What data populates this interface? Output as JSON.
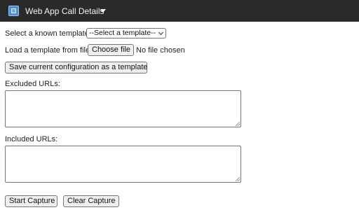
{
  "app": {
    "title": "Web App Call Details",
    "icon": "app-window-icon",
    "menu_icon": "chevron-down-icon"
  },
  "template": {
    "select_label": "Select a known template:",
    "select_value": "--Select a template--",
    "load_label": "Load a template from file:",
    "choose_file_label": "Choose file",
    "file_status": "No file chosen",
    "save_button_label": "Save current configuration as a template"
  },
  "urls": {
    "excluded_label": "Excluded URLs:",
    "excluded_value": "",
    "included_label": "Included URLs:",
    "included_value": ""
  },
  "capture": {
    "start_label": "Start Capture",
    "clear_label": "Clear Capture"
  },
  "colors": {
    "titlebar_bg": "#2a2a2a",
    "button_bg": "#efefef",
    "border": "#767676"
  }
}
